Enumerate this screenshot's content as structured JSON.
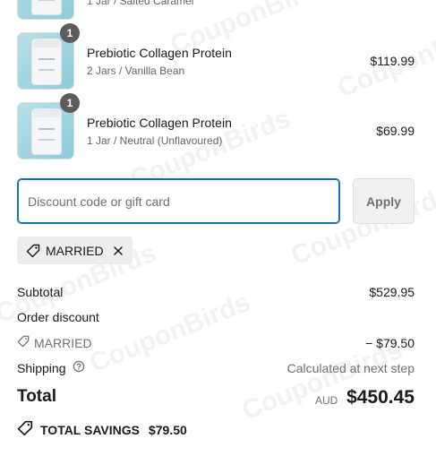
{
  "line_items": [
    {
      "quantity": "1",
      "name": "",
      "variant": "1 Jar / Salted Caramel",
      "price": ""
    },
    {
      "quantity": "1",
      "name": "Prebiotic Collagen Protein",
      "variant": "2 Jars / Vanilla Bean",
      "price": "$119.99"
    },
    {
      "quantity": "1",
      "name": "Prebiotic Collagen Protein",
      "variant": "1 Jar / Neutral (Unflavoured)",
      "price": "$69.99"
    }
  ],
  "discount": {
    "placeholder": "Discount code or gift card",
    "value": "",
    "apply_label": "Apply",
    "applied_code": "MARRIED"
  },
  "summary": {
    "subtotal_label": "Subtotal",
    "subtotal_value": "$529.95",
    "order_discount_label": "Order discount",
    "discount_code": "MARRIED",
    "discount_value": "− $79.50",
    "shipping_label": "Shipping",
    "shipping_value": "Calculated at next step",
    "total_label": "Total",
    "currency": "AUD",
    "total_value": "$450.45",
    "savings_label": "TOTAL SAVINGS",
    "savings_value": "$79.50"
  },
  "watermark": "CouponBirds",
  "icons": {
    "tag": "tag-icon",
    "close": "close-icon",
    "help": "help-circle-icon",
    "savings": "savings-tag-icon"
  },
  "colors": {
    "focus_border": "#1773b0",
    "muted_text": "#707070",
    "badge_bg": "#5c5c5c",
    "tag_bg": "#ededed"
  }
}
